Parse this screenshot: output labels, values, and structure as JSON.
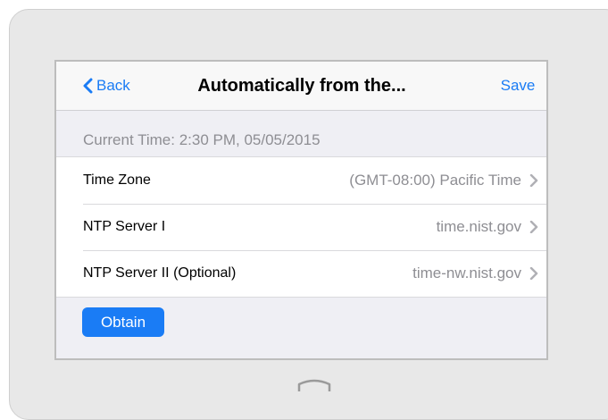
{
  "navbar": {
    "back_label": "Back",
    "title": "Automatically from the...",
    "save_label": "Save"
  },
  "current_time": "Current Time: 2:30 PM, 05/05/2015",
  "rows": [
    {
      "label": "Time Zone",
      "value": "(GMT-08:00) Pacific Time"
    },
    {
      "label": "NTP Server I",
      "value": "time.nist.gov"
    },
    {
      "label": "NTP Server II (Optional)",
      "value": "time-nw.nist.gov"
    }
  ],
  "obtain_label": "Obtain",
  "icons": {
    "back": "chevron-left-icon",
    "row": "chevron-right-icon",
    "home": "home-button-icon"
  },
  "colors": {
    "accent": "#1a7cf5",
    "background": "#efeff4",
    "secondary_text": "#8e8e93"
  }
}
